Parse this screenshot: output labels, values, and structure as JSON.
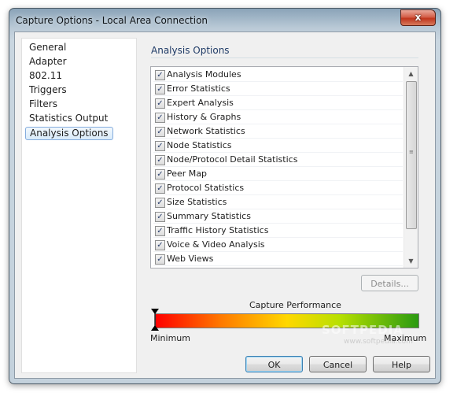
{
  "window": {
    "title": "Capture Options - Local Area Connection",
    "close_label": "x"
  },
  "nav": {
    "items": [
      {
        "label": "General"
      },
      {
        "label": "Adapter"
      },
      {
        "label": "802.11"
      },
      {
        "label": "Triggers"
      },
      {
        "label": "Filters"
      },
      {
        "label": "Statistics Output"
      },
      {
        "label": "Analysis Options"
      }
    ],
    "selected": "Analysis Options"
  },
  "section": {
    "title": "Analysis Options"
  },
  "options": [
    {
      "label": "Analysis Modules",
      "checked": true
    },
    {
      "label": "Error Statistics",
      "checked": true
    },
    {
      "label": "Expert Analysis",
      "checked": true
    },
    {
      "label": "History & Graphs",
      "checked": true
    },
    {
      "label": "Network Statistics",
      "checked": true
    },
    {
      "label": "Node Statistics",
      "checked": true
    },
    {
      "label": "Node/Protocol Detail Statistics",
      "checked": true
    },
    {
      "label": "Peer Map",
      "checked": true
    },
    {
      "label": "Protocol Statistics",
      "checked": true
    },
    {
      "label": "Size Statistics",
      "checked": true
    },
    {
      "label": "Summary Statistics",
      "checked": true
    },
    {
      "label": "Traffic History Statistics",
      "checked": true
    },
    {
      "label": "Voice & Video Analysis",
      "checked": true
    },
    {
      "label": "Web Views",
      "checked": true
    }
  ],
  "details_label": "Details...",
  "performance": {
    "title": "Capture Performance",
    "min_label": "Minimum",
    "max_label": "Maximum",
    "level": 0.0
  },
  "buttons": {
    "ok": "OK",
    "cancel": "Cancel",
    "help": "Help"
  },
  "watermark": "SOFTPEDIA",
  "watermark_url": "www.softpedia.com",
  "colors": {
    "selection_border": "#84acdd",
    "check": "#2a3f6d",
    "perf_low": "#ff0000",
    "perf_high": "#2a9a10"
  }
}
